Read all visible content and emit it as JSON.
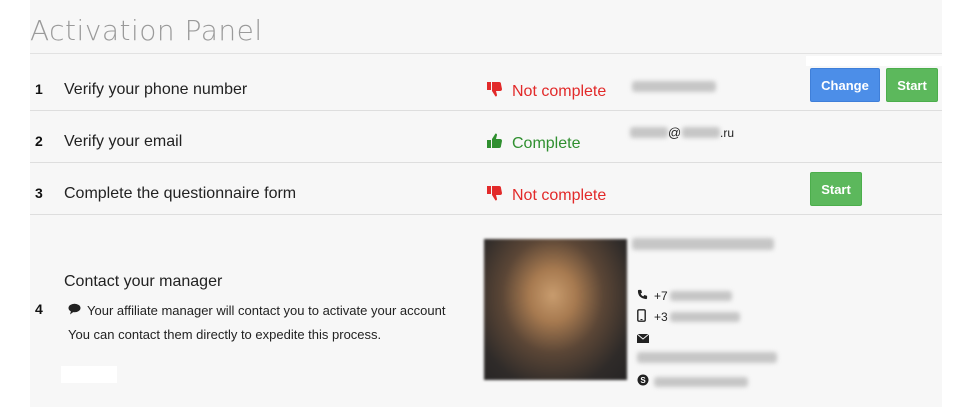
{
  "header": {
    "title": "Activation Panel"
  },
  "steps": [
    {
      "num": "1",
      "label": "Verify your phone number",
      "status": "Not complete",
      "action": "Start",
      "secondary_action": "Change"
    },
    {
      "num": "2",
      "label": "Verify your email",
      "status": "Complete",
      "email_at": "@",
      "email_tld": ".ru"
    },
    {
      "num": "3",
      "label": "Complete the questionnaire form",
      "status": "Not complete",
      "action": "Start"
    },
    {
      "num": "4",
      "label": "Contact your manager"
    }
  ],
  "manager": {
    "message": "Your affiliate manager will contact you to activate your account",
    "hint": "You can contact them directly to expedite this process.",
    "phone_prefix": "+7",
    "mobile_prefix": "+3"
  },
  "colors": {
    "accent_blue": "#4c8ee8",
    "accent_green": "#5cb85c",
    "status_bad": "#e22a2a",
    "status_good": "#2f8f2f"
  },
  "icons": {
    "not_complete": "thumbs-down-icon",
    "complete": "thumbs-up-icon",
    "message": "speech-bubble-icon",
    "phone": "phone-icon",
    "mobile": "mobile-icon",
    "email": "envelope-icon",
    "skype": "skype-icon"
  }
}
